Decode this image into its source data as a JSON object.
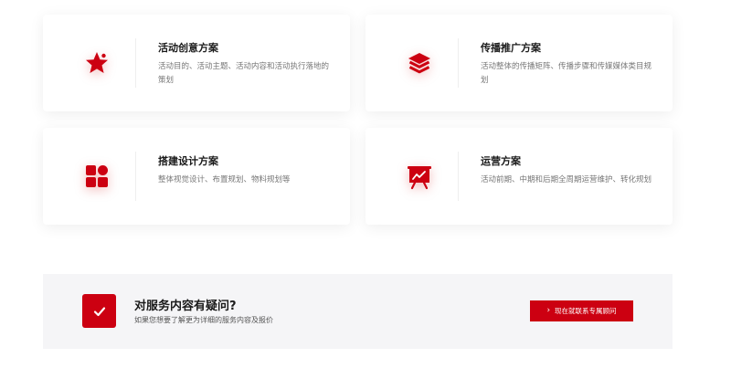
{
  "accent_color": "#cc0011",
  "services": [
    {
      "title": "活动创意方案",
      "description": "活动目的、活动主题、活动内容和活动执行落地的策划",
      "icon": "star-icon"
    },
    {
      "title": "传播推广方案",
      "description": "活动整体的传播矩阵、传播步骤和传媒媒体类目规划",
      "icon": "layers-icon"
    },
    {
      "title": "搭建设计方案",
      "description": "整体视觉设计、布置规划、物料规划等",
      "icon": "grid-apps-icon"
    },
    {
      "title": "运营方案",
      "description": "活动前期、中期和后期全周期运营维护、转化规划",
      "icon": "presentation-chart-icon"
    }
  ],
  "cta_banner": {
    "icon": "checkmark-icon",
    "title": "对服务内容有疑问?",
    "subtitle": "如果您想要了解更为详细的服务内容及报价",
    "button_label": "现在就联系专属顾问",
    "button_icon": "chevron-right-icon"
  }
}
